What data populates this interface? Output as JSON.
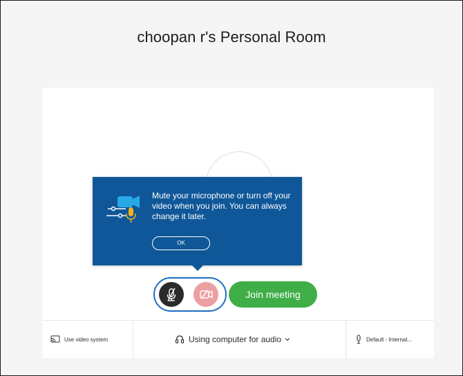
{
  "room": {
    "title": "choopan r's Personal Room"
  },
  "tooltip": {
    "message": "Mute your microphone or turn off your video when you join. You can always change it later.",
    "ok_label": "OK",
    "icon": "settings-camera-mic-illustration"
  },
  "controls": {
    "mute_icon": "microphone-muted-icon",
    "video_icon": "video-off-icon",
    "join_label": "Join meeting"
  },
  "bottom_bar": {
    "video_system": {
      "icon": "cast-icon",
      "label": "Use video system"
    },
    "audio": {
      "icon": "headset-icon",
      "label": "Using computer for audio"
    },
    "microphone": {
      "icon": "microphone-icon",
      "label": "Default - Internal..."
    }
  },
  "colors": {
    "tooltip_bg": "#0f5798",
    "join_green": "#3fae47",
    "toggle_border": "#1b6ec2",
    "mute_dark": "#2b2b2b",
    "video_off_pink": "#ec9fa1"
  }
}
